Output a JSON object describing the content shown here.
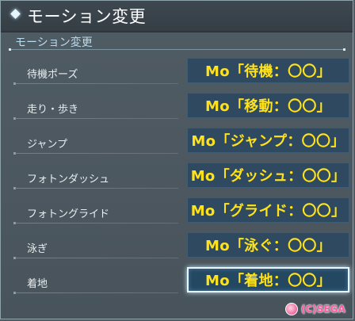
{
  "window": {
    "title": "モーション変更"
  },
  "section": {
    "label": "モーション変更"
  },
  "rows": [
    {
      "label": "待機ポーズ",
      "value": "Mo「待機：〇〇」"
    },
    {
      "label": "走り・歩き",
      "value": "Mo「移動：〇〇」"
    },
    {
      "label": "ジャンプ",
      "value": "Mo「ジャンプ：〇〇」"
    },
    {
      "label": "フォトンダッシュ",
      "value": "Mo「ダッシュ：〇〇」"
    },
    {
      "label": "フォトングライド",
      "value": "Mo「グライド：〇〇」"
    },
    {
      "label": "泳ぎ",
      "value": "Mo「泳ぐ：〇〇」"
    },
    {
      "label": "着地",
      "value": "Mo「着地：〇〇」"
    }
  ],
  "copyright": {
    "text": "(C)SEGA",
    "icon": "character-icon"
  }
}
